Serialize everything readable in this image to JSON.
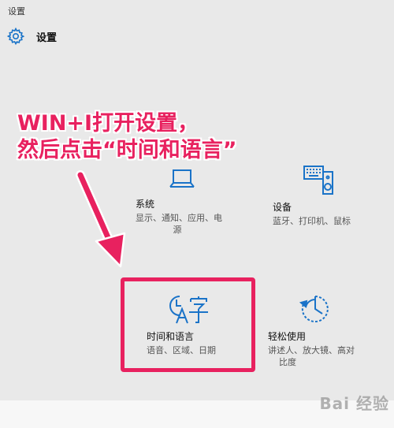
{
  "window": {
    "title": "设置"
  },
  "header": {
    "title": "设置",
    "icon": "gear-icon"
  },
  "annotation": {
    "line1": "WIN+I打开设置，",
    "line2": "然后点击“时间和语言”",
    "color": "#e8215f"
  },
  "tiles": {
    "system": {
      "name": "系统",
      "desc_line1": "显示、通知、应用、电",
      "desc_line2": "源",
      "icon": "laptop-icon"
    },
    "devices": {
      "name": "设备",
      "desc_line1": "蓝牙、打印机、鼠标",
      "icon": "devices-icon"
    },
    "time_language": {
      "name": "时间和语言",
      "desc_line1": "语音、区域、日期",
      "icon": "time-language-icon"
    },
    "ease_of_access": {
      "name": "轻松使用",
      "desc_line1": "讲述人、放大镜、高对",
      "desc_line2": "比度",
      "icon": "ease-of-access-icon"
    }
  },
  "watermark": {
    "text": "Bai 经验"
  },
  "accent_color": "#1a73c8"
}
